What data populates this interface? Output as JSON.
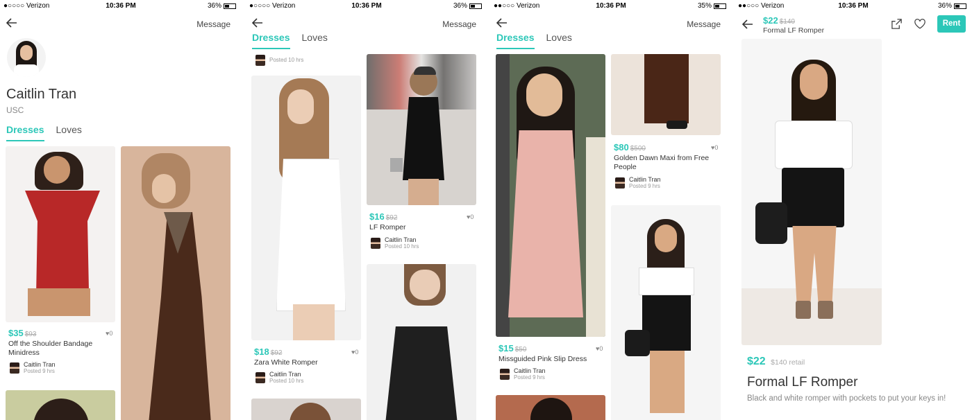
{
  "status_bar": [
    {
      "carrier": "●○○○○ Verizon",
      "time": "10:36 PM",
      "battery": "36%"
    },
    {
      "carrier": "●○○○○ Verizon",
      "time": "10:36 PM",
      "battery": "36%"
    },
    {
      "carrier": "●●○○○ Verizon",
      "time": "10:36 PM",
      "battery": "35%"
    },
    {
      "carrier": "●●○○○ Verizon",
      "time": "10:36 PM",
      "battery": "36%"
    }
  ],
  "common": {
    "message_label": "Message",
    "tab_dresses": "Dresses",
    "tab_loves": "Loves",
    "seller_name": "Caitlin Tran"
  },
  "profile": {
    "name": "Caitlin Tran",
    "school": "USC"
  },
  "screen1": {
    "cards": [
      {
        "price": "$35",
        "original": "$93",
        "likes": "♥0",
        "title": "Off the Shoulder Bandage Minidress",
        "posted": "Posted 9 hrs"
      }
    ]
  },
  "screen2": {
    "top_posted": "Posted 10 hrs",
    "cards": [
      {
        "price": "$18",
        "original": "$92",
        "likes": "♥0",
        "title": "Zara White Romper",
        "posted": "Posted 10 hrs"
      },
      {
        "price": "$16",
        "original": "$92",
        "likes": "♥0",
        "title": "LF Romper",
        "posted": "Posted 10 hrs"
      }
    ]
  },
  "screen3": {
    "cards": [
      {
        "price": "$15",
        "original": "$50",
        "likes": "♥0",
        "title": "Missguided Pink Slip Dress",
        "posted": "Posted 9 hrs"
      },
      {
        "price": "$80",
        "original": "$500",
        "likes": "♥0",
        "title": "Golden Dawn Maxi from Free People",
        "posted": "Posted 9 hrs"
      }
    ]
  },
  "detail": {
    "header_price": "$22",
    "header_original": "$140",
    "header_title": "Formal LF Romper",
    "rent_label": "Rent",
    "price": "$22",
    "retail": "$140 retail",
    "title": "Formal LF Romper",
    "description": "Black and white romper with pockets to put your keys in!"
  },
  "colors": {
    "accent": "#2cc7b8"
  }
}
